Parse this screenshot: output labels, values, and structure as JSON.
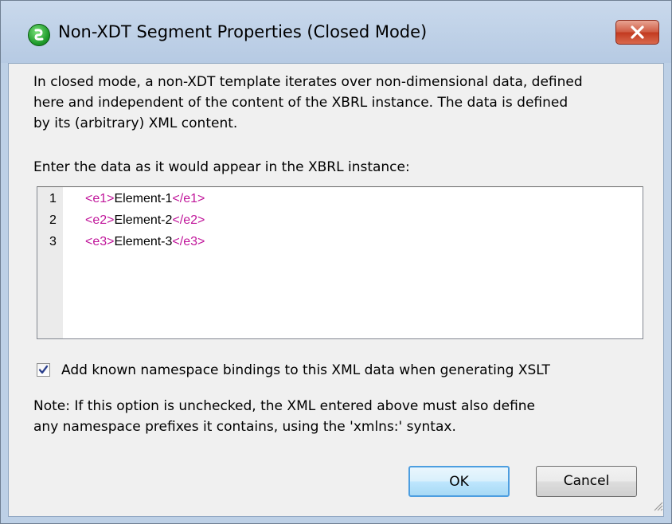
{
  "window": {
    "title": "Non-XDT Segment Properties (Closed Mode)",
    "icon": "altova-app-icon",
    "close_icon": "close-icon"
  },
  "description": {
    "lines": [
      "In closed mode, a non-XDT template iterates over non-dimensional data, defined",
      "here and independent of the content of the XBRL instance. The data is defined",
      "by its (arbitrary) XML content."
    ]
  },
  "editor": {
    "label": "Enter the data as it would appear in the XBRL instance:",
    "lines": [
      {
        "number": "1",
        "open_name": "e1",
        "content": "Element-1",
        "close_name": "e1"
      },
      {
        "number": "2",
        "open_name": "e2",
        "content": "Element-2",
        "close_name": "e2"
      },
      {
        "number": "3",
        "open_name": "e3",
        "content": "Element-3",
        "close_name": "e3"
      }
    ]
  },
  "namespace_option": {
    "checked": true,
    "label": "Add known namespace bindings to this XML data when generating XSLT"
  },
  "note": {
    "lines": [
      "Note: If this option is unchecked, the XML entered above must also define",
      "any namespace prefixes it contains, using the 'xmlns:' syntax."
    ]
  },
  "buttons": {
    "ok": "OK",
    "cancel": "Cancel"
  },
  "colors": {
    "tag_bracket": "#c0159a",
    "tag_name": "#1b2cd4",
    "titlebar": "#bdd0e6"
  }
}
